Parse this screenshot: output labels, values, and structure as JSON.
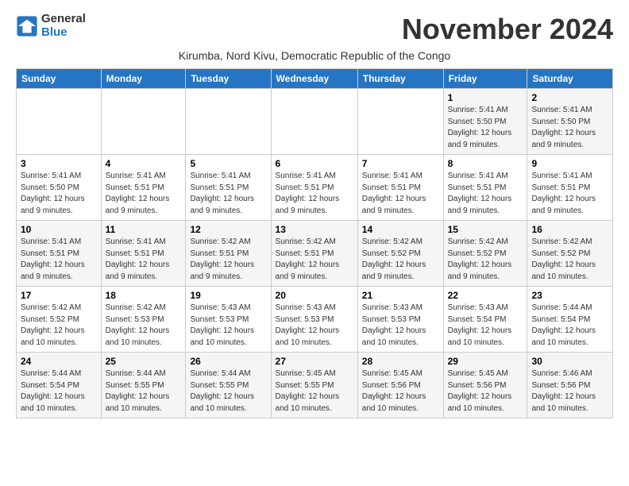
{
  "header": {
    "logo_general": "General",
    "logo_blue": "Blue",
    "month_title": "November 2024",
    "subtitle": "Kirumba, Nord Kivu, Democratic Republic of the Congo"
  },
  "days_of_week": [
    "Sunday",
    "Monday",
    "Tuesday",
    "Wednesday",
    "Thursday",
    "Friday",
    "Saturday"
  ],
  "weeks": [
    [
      {
        "day": "",
        "info": ""
      },
      {
        "day": "",
        "info": ""
      },
      {
        "day": "",
        "info": ""
      },
      {
        "day": "",
        "info": ""
      },
      {
        "day": "",
        "info": ""
      },
      {
        "day": "1",
        "info": "Sunrise: 5:41 AM\nSunset: 5:50 PM\nDaylight: 12 hours and 9 minutes."
      },
      {
        "day": "2",
        "info": "Sunrise: 5:41 AM\nSunset: 5:50 PM\nDaylight: 12 hours and 9 minutes."
      }
    ],
    [
      {
        "day": "3",
        "info": "Sunrise: 5:41 AM\nSunset: 5:50 PM\nDaylight: 12 hours and 9 minutes."
      },
      {
        "day": "4",
        "info": "Sunrise: 5:41 AM\nSunset: 5:51 PM\nDaylight: 12 hours and 9 minutes."
      },
      {
        "day": "5",
        "info": "Sunrise: 5:41 AM\nSunset: 5:51 PM\nDaylight: 12 hours and 9 minutes."
      },
      {
        "day": "6",
        "info": "Sunrise: 5:41 AM\nSunset: 5:51 PM\nDaylight: 12 hours and 9 minutes."
      },
      {
        "day": "7",
        "info": "Sunrise: 5:41 AM\nSunset: 5:51 PM\nDaylight: 12 hours and 9 minutes."
      },
      {
        "day": "8",
        "info": "Sunrise: 5:41 AM\nSunset: 5:51 PM\nDaylight: 12 hours and 9 minutes."
      },
      {
        "day": "9",
        "info": "Sunrise: 5:41 AM\nSunset: 5:51 PM\nDaylight: 12 hours and 9 minutes."
      }
    ],
    [
      {
        "day": "10",
        "info": "Sunrise: 5:41 AM\nSunset: 5:51 PM\nDaylight: 12 hours and 9 minutes."
      },
      {
        "day": "11",
        "info": "Sunrise: 5:41 AM\nSunset: 5:51 PM\nDaylight: 12 hours and 9 minutes."
      },
      {
        "day": "12",
        "info": "Sunrise: 5:42 AM\nSunset: 5:51 PM\nDaylight: 12 hours and 9 minutes."
      },
      {
        "day": "13",
        "info": "Sunrise: 5:42 AM\nSunset: 5:51 PM\nDaylight: 12 hours and 9 minutes."
      },
      {
        "day": "14",
        "info": "Sunrise: 5:42 AM\nSunset: 5:52 PM\nDaylight: 12 hours and 9 minutes."
      },
      {
        "day": "15",
        "info": "Sunrise: 5:42 AM\nSunset: 5:52 PM\nDaylight: 12 hours and 9 minutes."
      },
      {
        "day": "16",
        "info": "Sunrise: 5:42 AM\nSunset: 5:52 PM\nDaylight: 12 hours and 10 minutes."
      }
    ],
    [
      {
        "day": "17",
        "info": "Sunrise: 5:42 AM\nSunset: 5:52 PM\nDaylight: 12 hours and 10 minutes."
      },
      {
        "day": "18",
        "info": "Sunrise: 5:42 AM\nSunset: 5:53 PM\nDaylight: 12 hours and 10 minutes."
      },
      {
        "day": "19",
        "info": "Sunrise: 5:43 AM\nSunset: 5:53 PM\nDaylight: 12 hours and 10 minutes."
      },
      {
        "day": "20",
        "info": "Sunrise: 5:43 AM\nSunset: 5:53 PM\nDaylight: 12 hours and 10 minutes."
      },
      {
        "day": "21",
        "info": "Sunrise: 5:43 AM\nSunset: 5:53 PM\nDaylight: 12 hours and 10 minutes."
      },
      {
        "day": "22",
        "info": "Sunrise: 5:43 AM\nSunset: 5:54 PM\nDaylight: 12 hours and 10 minutes."
      },
      {
        "day": "23",
        "info": "Sunrise: 5:44 AM\nSunset: 5:54 PM\nDaylight: 12 hours and 10 minutes."
      }
    ],
    [
      {
        "day": "24",
        "info": "Sunrise: 5:44 AM\nSunset: 5:54 PM\nDaylight: 12 hours and 10 minutes."
      },
      {
        "day": "25",
        "info": "Sunrise: 5:44 AM\nSunset: 5:55 PM\nDaylight: 12 hours and 10 minutes."
      },
      {
        "day": "26",
        "info": "Sunrise: 5:44 AM\nSunset: 5:55 PM\nDaylight: 12 hours and 10 minutes."
      },
      {
        "day": "27",
        "info": "Sunrise: 5:45 AM\nSunset: 5:55 PM\nDaylight: 12 hours and 10 minutes."
      },
      {
        "day": "28",
        "info": "Sunrise: 5:45 AM\nSunset: 5:56 PM\nDaylight: 12 hours and 10 minutes."
      },
      {
        "day": "29",
        "info": "Sunrise: 5:45 AM\nSunset: 5:56 PM\nDaylight: 12 hours and 10 minutes."
      },
      {
        "day": "30",
        "info": "Sunrise: 5:46 AM\nSunset: 5:56 PM\nDaylight: 12 hours and 10 minutes."
      }
    ]
  ]
}
